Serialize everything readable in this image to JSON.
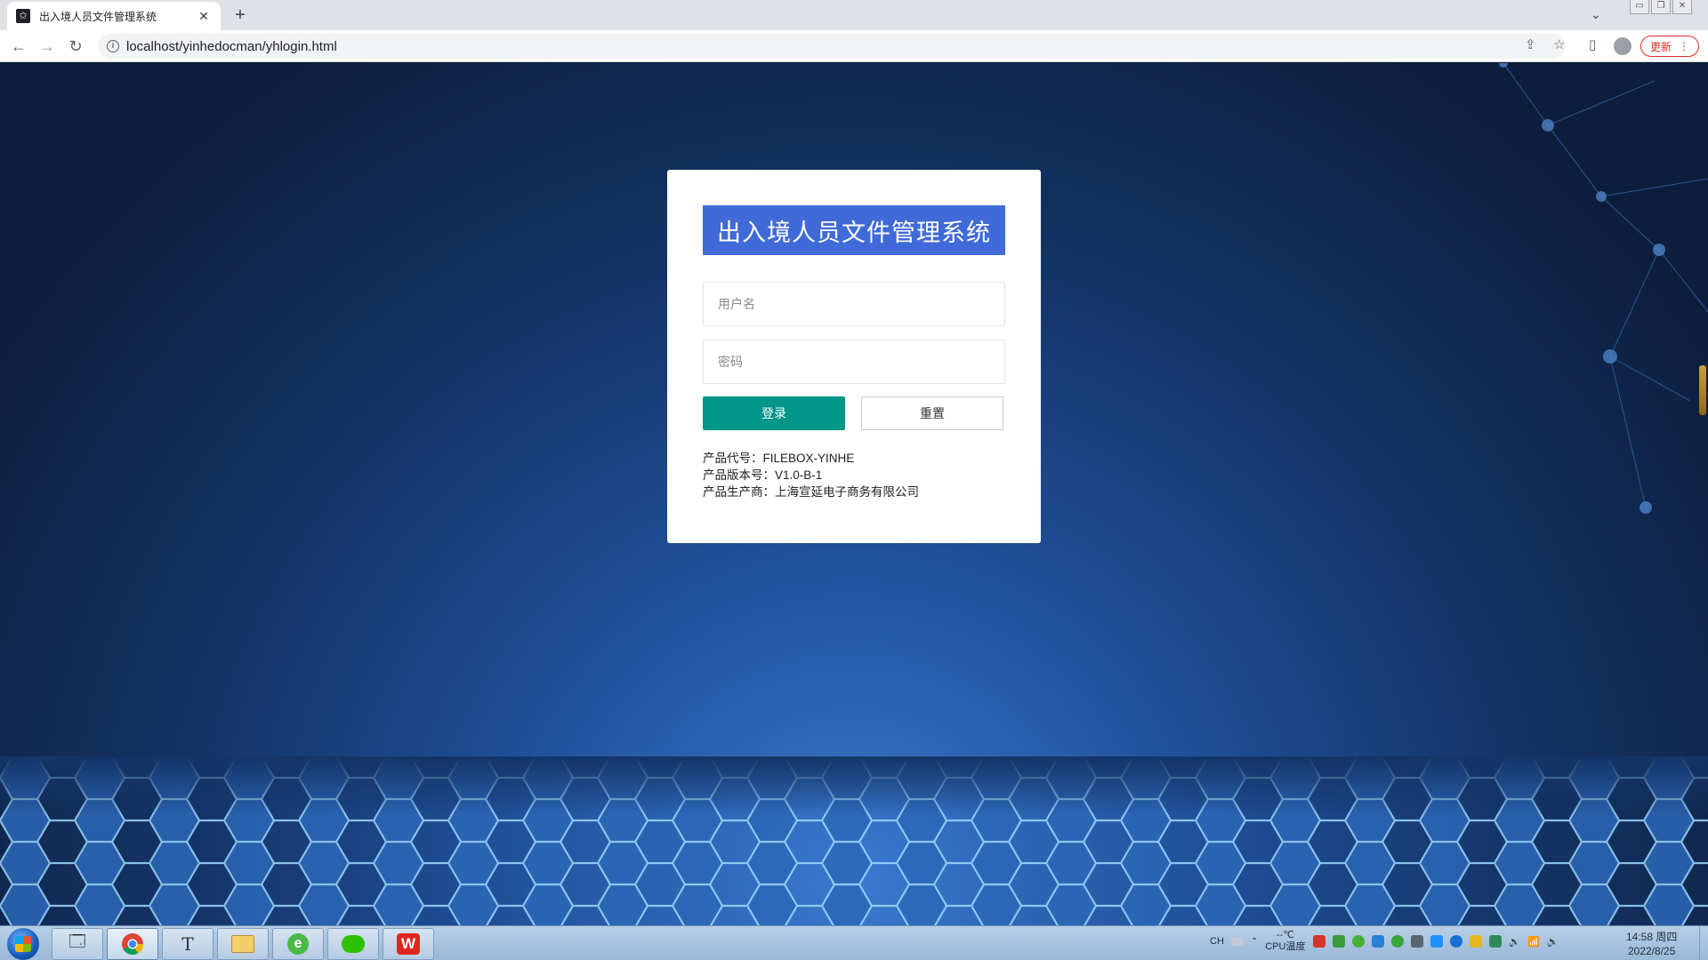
{
  "browser": {
    "tab_title": "出入境人员文件管理系统",
    "tab_close": "✕",
    "new_tab": "+",
    "url": "localhost/yinhedocman/yhlogin.html",
    "update_label": "更新",
    "icons": [
      "back-icon",
      "forward-icon",
      "reload-icon",
      "info-icon",
      "share-icon",
      "bookmark-star-icon",
      "side-panel-icon",
      "profile-icon",
      "menu-icon"
    ]
  },
  "login": {
    "system_title": "出入境人员文件管理系统",
    "username_placeholder": "用户名",
    "password_placeholder": "密码",
    "login_label": "登录",
    "reset_label": "重置",
    "product_code": "产品代号：FILEBOX-YINHE",
    "product_version": "产品版本号：V1.0-B-1",
    "product_vendor": "产品生产商：上海宣延电子商务有限公司"
  },
  "colors": {
    "title_bg": "#3f6ad8",
    "login_btn": "#009688",
    "update_red": "#d93025"
  },
  "taskbar": {
    "apps": [
      "explorer-icon",
      "chrome-icon",
      "text-editor-icon",
      "file-manager-icon",
      "browser-e-icon",
      "wechat-icon",
      "wps-icon"
    ],
    "lang": "CH",
    "cpu_temp": "--℃",
    "cpu_label": "CPU温度",
    "time": "14:58 周四",
    "date": "2022/8/25"
  }
}
